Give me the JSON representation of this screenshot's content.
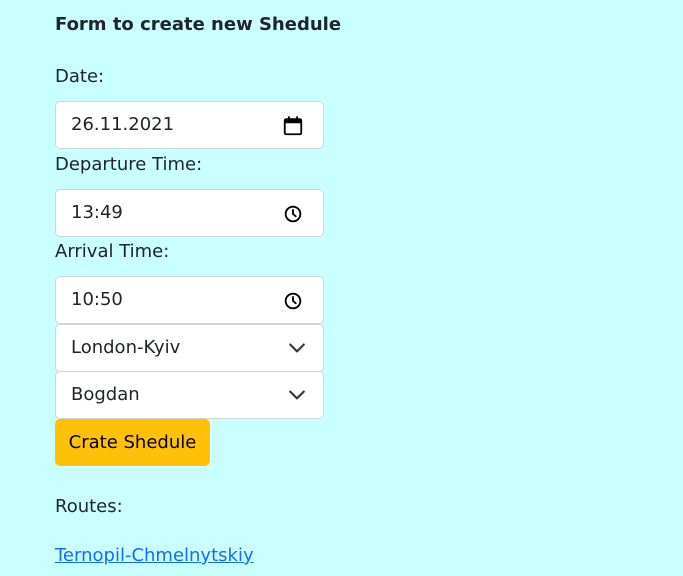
{
  "form": {
    "title": "Form to create new Shedule",
    "date": {
      "label": "Date:",
      "value": "26.11.2021",
      "icon": "calendar-icon"
    },
    "departure": {
      "label": "Departure Time:",
      "value": "13:49",
      "icon": "clock-icon"
    },
    "arrival": {
      "label": "Arrival Time:",
      "value": "10:50",
      "icon": "clock-icon"
    },
    "route_select": {
      "value": "London-Kyiv",
      "icon": "chevron-down-icon"
    },
    "driver_select": {
      "value": "Bogdan",
      "icon": "chevron-down-icon"
    },
    "submit_label": "Crate Shedule"
  },
  "routes": {
    "label": "Routes:",
    "items": [
      "Ternopil-Chmelnytskiy"
    ]
  },
  "colors": {
    "background": "#caffff",
    "button": "#ffc107",
    "link": "#0d6efd",
    "text": "#212529"
  }
}
